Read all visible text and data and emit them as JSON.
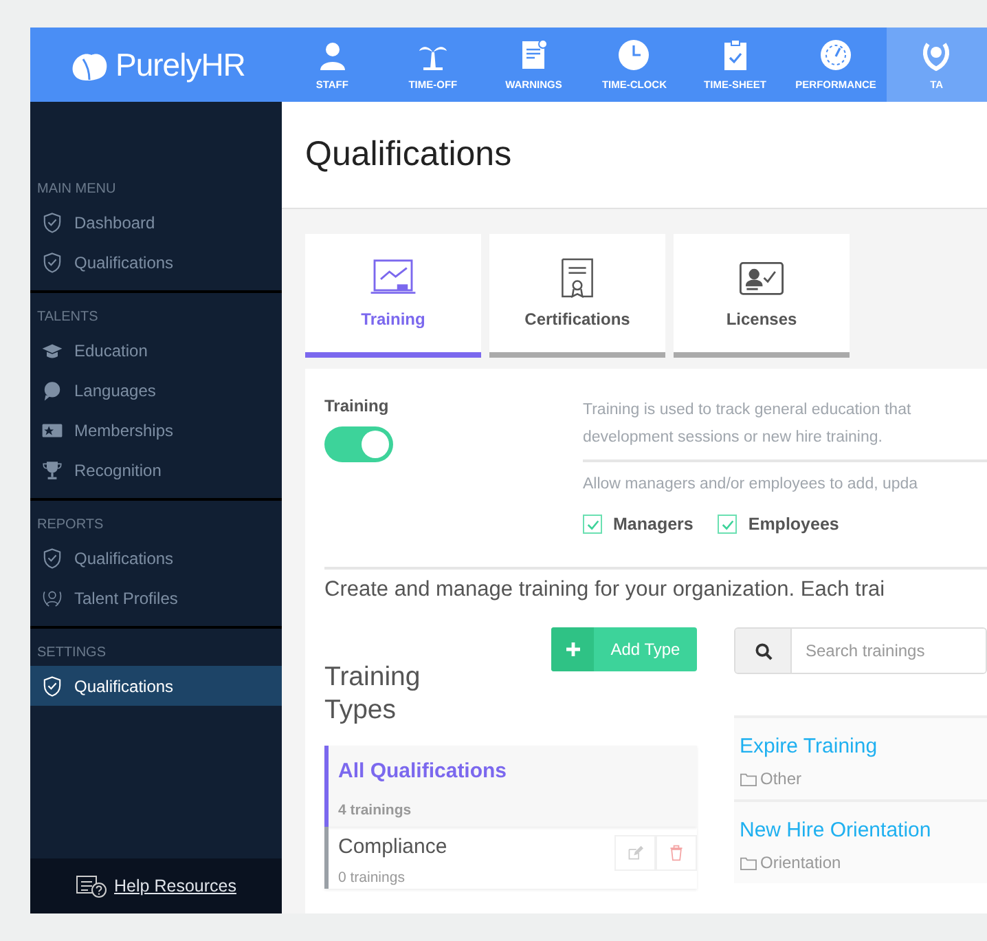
{
  "brand": {
    "name": "PurelyHR"
  },
  "nav": [
    {
      "label": "STAFF",
      "selected": false
    },
    {
      "label": "TIME-OFF",
      "selected": false
    },
    {
      "label": "WARNINGS",
      "selected": false
    },
    {
      "label": "TIME-CLOCK",
      "selected": false
    },
    {
      "label": "TIME-SHEET",
      "selected": false
    },
    {
      "label": "PERFORMANCE",
      "selected": false
    },
    {
      "label": "TA",
      "selected": true
    }
  ],
  "sidebar": {
    "sections": [
      {
        "heading": "MAIN MENU",
        "items": [
          {
            "label": "Dashboard",
            "selected": false
          },
          {
            "label": "Qualifications",
            "selected": false
          }
        ]
      },
      {
        "heading": "TALENTS",
        "items": [
          {
            "label": "Education",
            "selected": false
          },
          {
            "label": "Languages",
            "selected": false
          },
          {
            "label": "Memberships",
            "selected": false
          },
          {
            "label": "Recognition",
            "selected": false
          }
        ]
      },
      {
        "heading": "REPORTS",
        "items": [
          {
            "label": "Qualifications",
            "selected": false
          },
          {
            "label": "Talent Profiles",
            "selected": false
          }
        ]
      },
      {
        "heading": "SETTINGS",
        "items": [
          {
            "label": "Qualifications",
            "selected": true
          }
        ]
      }
    ],
    "help": "Help Resources"
  },
  "page": {
    "title": "Qualifications",
    "tabs": [
      {
        "label": "Training",
        "selected": true
      },
      {
        "label": "Certifications",
        "selected": false
      },
      {
        "label": "Licenses",
        "selected": false
      }
    ],
    "setting": {
      "label": "Training",
      "on": true,
      "description": [
        "Training is used to track general education that",
        "development sessions or new hire training."
      ],
      "permission_text": "Allow managers and/or employees to add, upda",
      "checkboxes": [
        {
          "label": "Managers",
          "checked": true
        },
        {
          "label": "Employees",
          "checked": true
        }
      ]
    },
    "intro": "Create and manage training for your organization. Each trai",
    "types": {
      "heading": "Training Types",
      "add_button": "Add Type",
      "items": [
        {
          "name": "All Qualifications",
          "count": "4 trainings",
          "selected": true
        },
        {
          "name": "Compliance",
          "count": "0 trainings",
          "selected": false
        }
      ]
    },
    "search": {
      "placeholder": "Search trainings"
    },
    "trainings": [
      {
        "name": "Expire Training",
        "category": "Other"
      },
      {
        "name": "New Hire Orientation",
        "category": "Orientation"
      }
    ]
  }
}
